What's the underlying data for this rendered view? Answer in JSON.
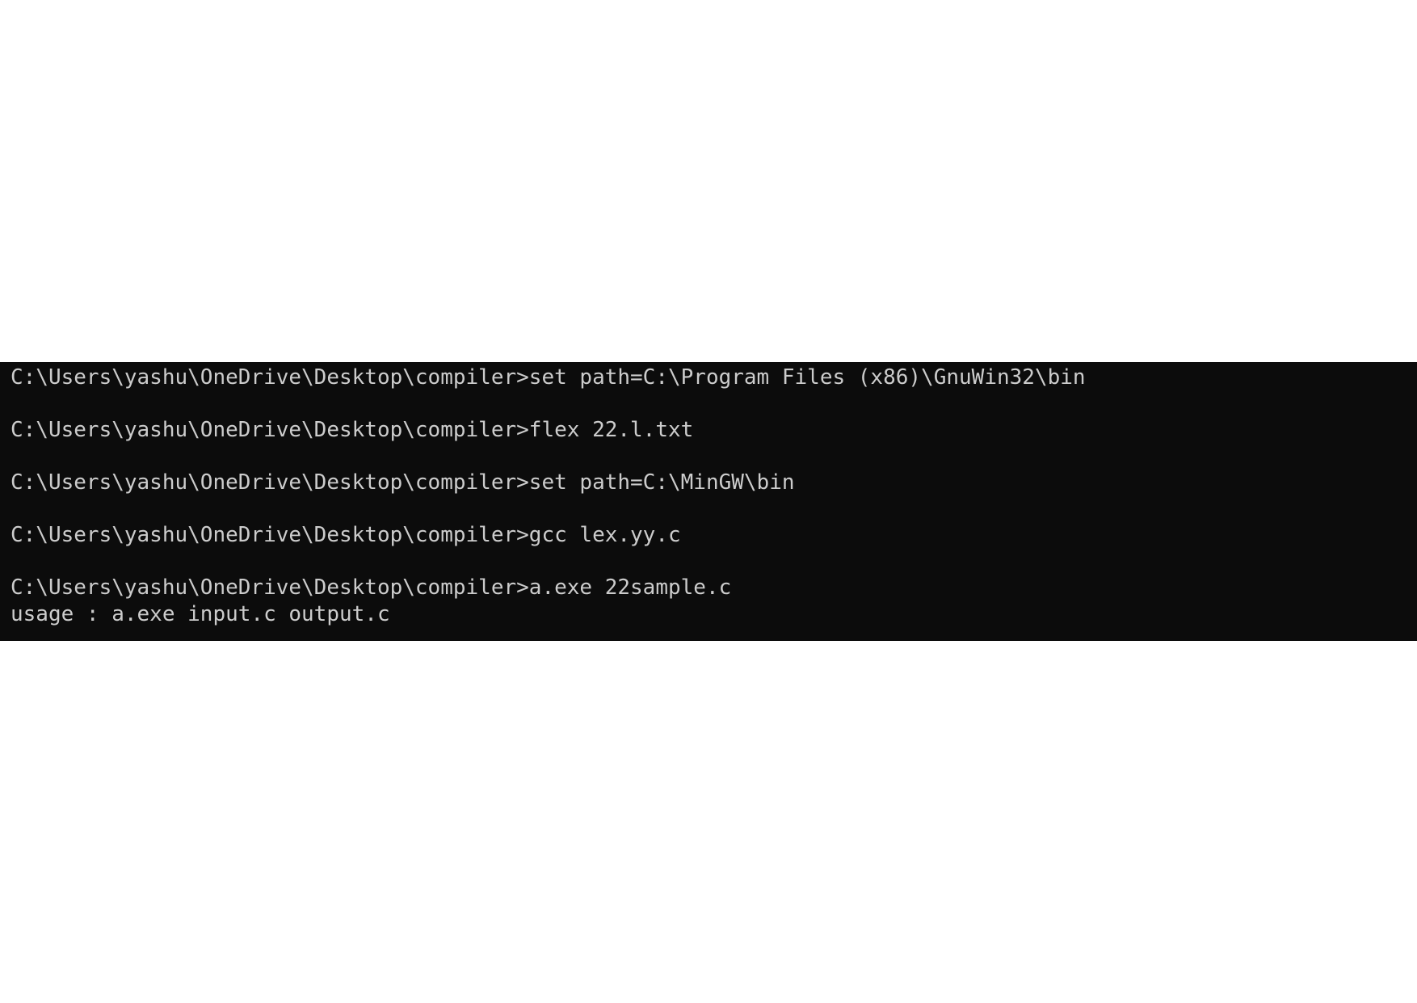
{
  "terminal": {
    "lines": [
      {
        "prompt": "C:\\Users\\yashu\\OneDrive\\Desktop\\compiler>",
        "command": "set path=C:\\Program Files (x86)\\GnuWin32\\bin"
      },
      {
        "prompt": "C:\\Users\\yashu\\OneDrive\\Desktop\\compiler>",
        "command": "flex 22.l.txt"
      },
      {
        "prompt": "C:\\Users\\yashu\\OneDrive\\Desktop\\compiler>",
        "command": "set path=C:\\MinGW\\bin"
      },
      {
        "prompt": "C:\\Users\\yashu\\OneDrive\\Desktop\\compiler>",
        "command": "gcc lex.yy.c"
      },
      {
        "prompt": "C:\\Users\\yashu\\OneDrive\\Desktop\\compiler>",
        "command": "a.exe 22sample.c"
      }
    ],
    "output": "usage : a.exe input.c output.c"
  },
  "colors": {
    "background": "#0c0c0c",
    "text": "#cccccc",
    "page": "#ffffff"
  }
}
